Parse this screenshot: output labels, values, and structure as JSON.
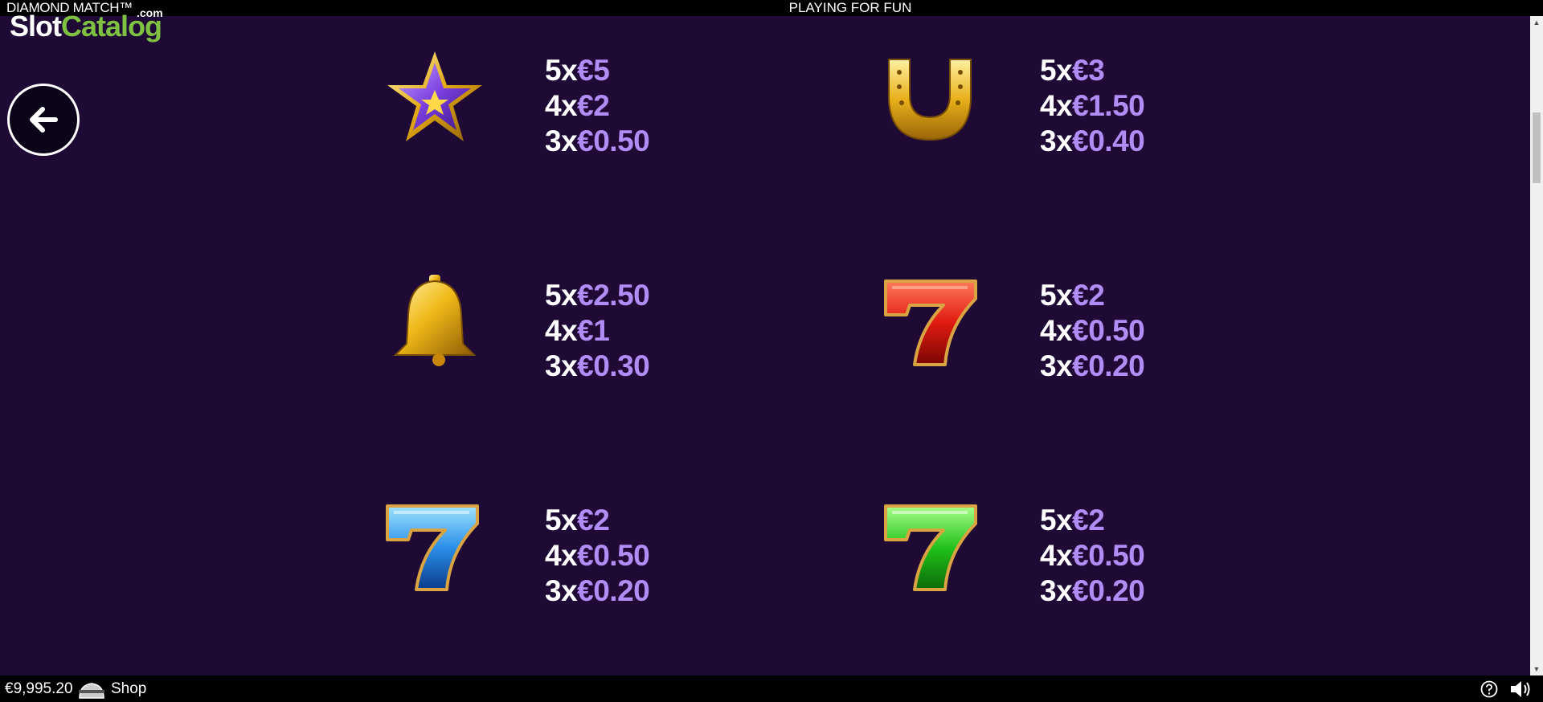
{
  "topbar": {
    "game_title": "DIAMOND MATCH™",
    "mode": "PLAYING FOR FUN"
  },
  "watermark": {
    "part1": "Slot",
    "part2": "Catalog",
    "suffix": ".com"
  },
  "back_button": {
    "icon": "arrow-left-icon"
  },
  "paytable": [
    {
      "symbol": "purple-star-icon",
      "lines": [
        {
          "count": "5x",
          "amount": "€5"
        },
        {
          "count": "4x",
          "amount": "€2"
        },
        {
          "count": "3x",
          "amount": "€0.50"
        }
      ]
    },
    {
      "symbol": "horseshoe-icon",
      "lines": [
        {
          "count": "5x",
          "amount": "€3"
        },
        {
          "count": "4x",
          "amount": "€1.50"
        },
        {
          "count": "3x",
          "amount": "€0.40"
        }
      ]
    },
    {
      "symbol": "bell-icon",
      "lines": [
        {
          "count": "5x",
          "amount": "€2.50"
        },
        {
          "count": "4x",
          "amount": "€1"
        },
        {
          "count": "3x",
          "amount": "€0.30"
        }
      ]
    },
    {
      "symbol": "red-seven-icon",
      "lines": [
        {
          "count": "5x",
          "amount": "€2"
        },
        {
          "count": "4x",
          "amount": "€0.50"
        },
        {
          "count": "3x",
          "amount": "€0.20"
        }
      ]
    },
    {
      "symbol": "blue-seven-icon",
      "lines": [
        {
          "count": "5x",
          "amount": "€2"
        },
        {
          "count": "4x",
          "amount": "€0.50"
        },
        {
          "count": "3x",
          "amount": "€0.20"
        }
      ]
    },
    {
      "symbol": "green-seven-icon",
      "lines": [
        {
          "count": "5x",
          "amount": "€2"
        },
        {
          "count": "4x",
          "amount": "€0.50"
        },
        {
          "count": "3x",
          "amount": "€0.20"
        }
      ]
    }
  ],
  "bottombar": {
    "balance": "€9,995.20",
    "shop_label": "Shop"
  },
  "colors": {
    "background": "#1f0a36",
    "count_text": "#ffffff",
    "amount_text": "#b08cf5",
    "watermark_green": "#7fc241"
  }
}
